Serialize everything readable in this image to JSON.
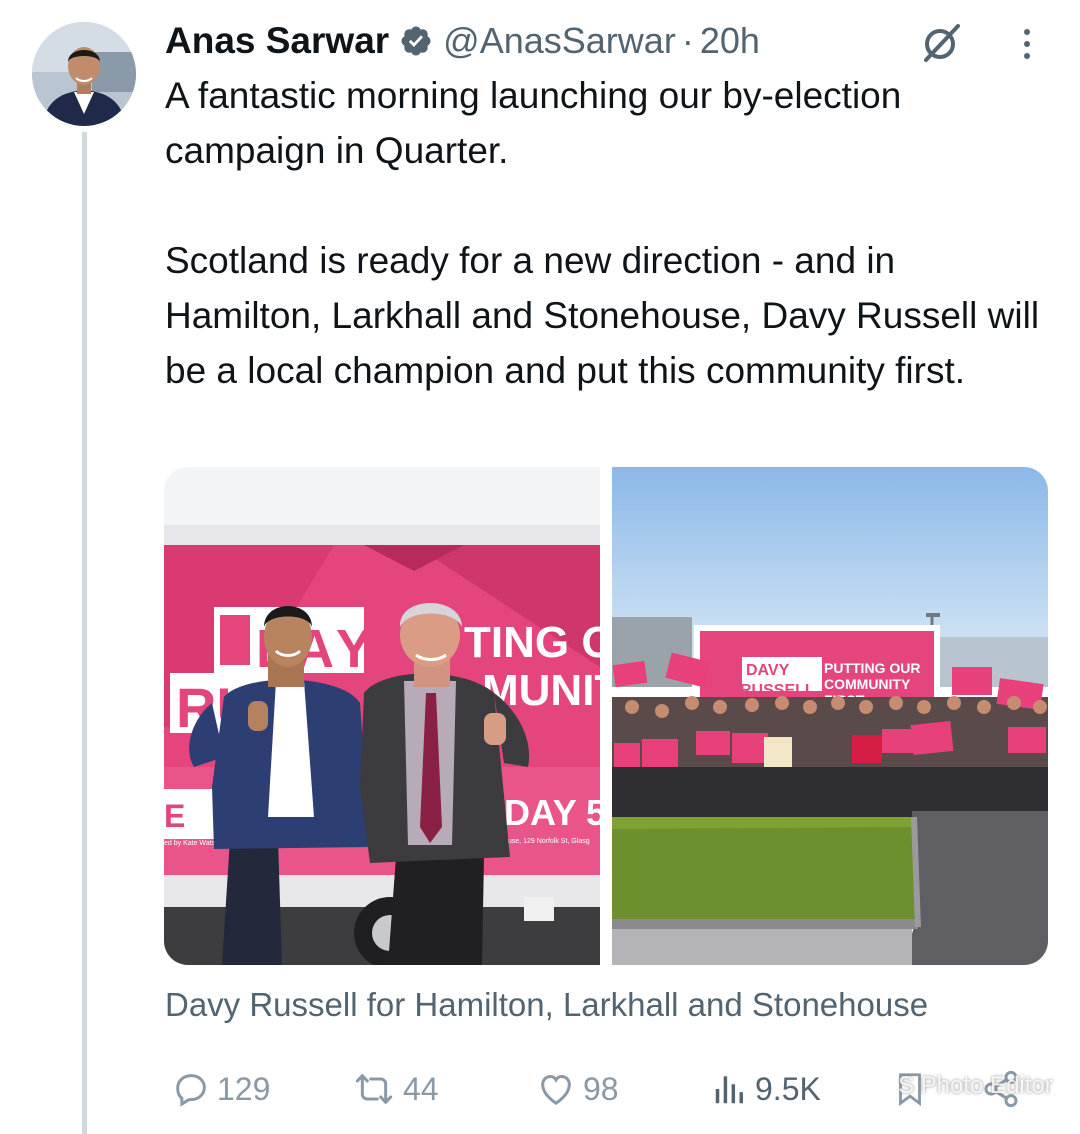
{
  "author": {
    "display_name": "Anas Sarwar",
    "handle": "@AnasSarwar",
    "separator": "·",
    "time": "20h",
    "verified_icon": "verified-badge-icon",
    "avatar_icon": "profile-avatar"
  },
  "tweet": {
    "paragraphs": [
      "A fantastic morning launching our by-election campaign in Quarter.",
      "Scotland is ready for a new direction - and in Hamilton, Larkhall and Stonehouse, Davy Russell will be a local champion and put this community first."
    ]
  },
  "media": {
    "photo1": {
      "billboard_name_line1": "DA",
      "billboard_name_line1b": "Y",
      "billboard_name_line2": "RU",
      "billboard_slogan_line1": "TING OUR",
      "billboard_slogan_line2": "MUNITY",
      "billboard_day": "DAY 5",
      "billboard_sc": "Sc",
      "billboard_fine_left": "ed by Kate Watson",
      "billboard_fine_right": "ouse, 129 Norfolk St, Glasg"
    },
    "photo2": {
      "billboard_name_line1": "DAVY",
      "billboard_name_line2": "RUSSELL",
      "billboard_slogan_line1": "PUTTING OUR",
      "billboard_slogan_line2": "COMMUNITY",
      "billboard_slogan_line3": "FIRST"
    },
    "caption": "Davy Russell for Hamilton, Larkhall and Stonehouse"
  },
  "actions": {
    "replies": "129",
    "reposts": "44",
    "likes": "98",
    "views": "9.5K"
  },
  "watermark": "S Photo Editor",
  "colors": {
    "text_primary": "#0f1419",
    "text_secondary": "#536471",
    "action_gray": "#8b98a5",
    "labour_pink": "#e0457b",
    "labour_red": "#d8102f",
    "verified_blue": "#536471"
  }
}
